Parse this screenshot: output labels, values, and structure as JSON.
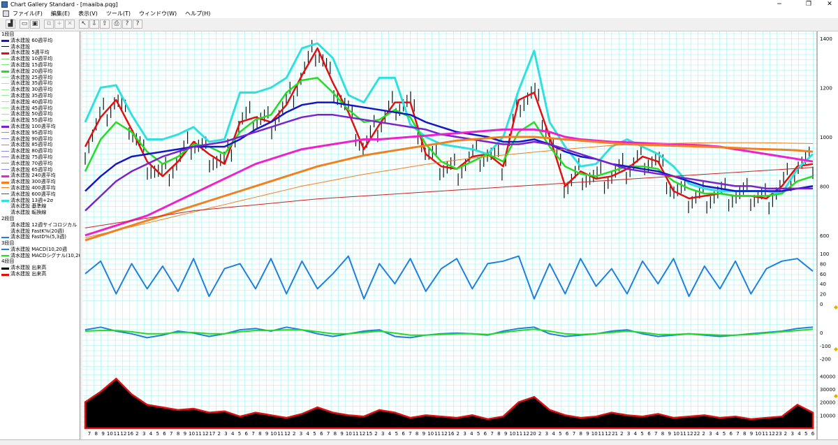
{
  "window": {
    "title": "Chart Gallery Standard - [maaiba.pqg]",
    "minimize": "−",
    "maximize": "❐",
    "close": "✕"
  },
  "menu": [
    "ファイル(F)",
    "編集(E)",
    "表示(V)",
    "ツール(T)",
    "ウィンドウ(W)",
    "ヘルプ(H)"
  ],
  "toolbar": [
    {
      "icon": "chart-icon",
      "glyph": "▟"
    },
    {
      "icon": "open-icon",
      "glyph": "▭"
    },
    {
      "icon": "save-icon",
      "glyph": "▣"
    },
    {
      "icon": "copy-icon",
      "glyph": "⧉"
    },
    {
      "icon": "add-icon",
      "glyph": "+"
    },
    {
      "icon": "delete-icon",
      "glyph": "✕"
    },
    {
      "icon": "cursor-icon",
      "glyph": "↖"
    },
    {
      "icon": "down-icon",
      "glyph": "⇩"
    },
    {
      "icon": "up-icon",
      "glyph": "⇧"
    },
    {
      "icon": "print-icon",
      "glyph": "⎙"
    },
    {
      "icon": "info-icon",
      "glyph": "?"
    },
    {
      "icon": "help-icon",
      "glyph": "?"
    }
  ],
  "legend": [
    {
      "text": "1段目",
      "section": true
    },
    {
      "text": "清水建設 60週平均",
      "color": "#1515c8",
      "w": 3
    },
    {
      "text": "清水建設",
      "color": "#000000",
      "w": 1
    },
    {
      "text": "清水建設 5週平均",
      "color": "#e01010",
      "w": 3
    },
    {
      "text": "清水建設 10週平均",
      "color": "#80e080",
      "w": 1
    },
    {
      "text": "清水建設 15週平均",
      "color": "#80e080",
      "w": 1
    },
    {
      "text": "清水建設 20週平均",
      "color": "#22dd22",
      "w": 3
    },
    {
      "text": "清水建設 25週平均",
      "color": "#a0e8a0",
      "w": 1
    },
    {
      "text": "清水建設 35週平均",
      "color": "#a0e8a0",
      "w": 1
    },
    {
      "text": "清水建設 30週平均",
      "color": "#a0e8a0",
      "w": 1
    },
    {
      "text": "清水建設 35週平均",
      "color": "#a0e8a0",
      "w": 1
    },
    {
      "text": "清水建設 40週平均",
      "color": "#a0e8a0",
      "w": 1
    },
    {
      "text": "清水建設 45週平均",
      "color": "#a0e8a0",
      "w": 1
    },
    {
      "text": "清水建設 50週平均",
      "color": "#a0e8a0",
      "w": 1
    },
    {
      "text": "清水建設 55週平均",
      "color": "#a0e8a0",
      "w": 1
    },
    {
      "text": "清水建設 100週平均",
      "color": "#7a22cc",
      "w": 3
    },
    {
      "text": "清水建設 95週平均",
      "color": "#8888e0",
      "w": 1
    },
    {
      "text": "清水建設 90週平均",
      "color": "#8888e0",
      "w": 1
    },
    {
      "text": "清水建設 85週平均",
      "color": "#8888e0",
      "w": 1
    },
    {
      "text": "清水建設 80週平均",
      "color": "#8888e0",
      "w": 1
    },
    {
      "text": "清水建設 75週平均",
      "color": "#8888e0",
      "w": 1
    },
    {
      "text": "清水建設 70週平均",
      "color": "#8888e0",
      "w": 1
    },
    {
      "text": "清水建設 65週平均",
      "color": "#8888e0",
      "w": 1
    },
    {
      "text": "清水建設 240週平均",
      "color": "#ee22cc",
      "w": 3
    },
    {
      "text": "清水建設 300週平均",
      "color": "#f08020",
      "w": 3
    },
    {
      "text": "清水建設 400週平均",
      "color": "#f08020",
      "w": 1
    },
    {
      "text": "清水建設 600週平均",
      "color": "#d02020",
      "w": 1
    },
    {
      "text": "清水建設 13週+2σ",
      "color": "#30e0e0",
      "w": 3
    },
    {
      "text": "清水建設 基準線",
      "color": null,
      "w": 0
    },
    {
      "text": "清水建設 転換線",
      "color": null,
      "w": 0
    },
    {
      "text": "2段目",
      "section": true
    },
    {
      "text": "清水建設 12週サイコロジカル",
      "color": null,
      "w": 0
    },
    {
      "text": "清水建設 FastK%(20週)",
      "color": null,
      "w": 0
    },
    {
      "text": "清水建設 FastD%(5,3週)",
      "color": "#1e7fe0",
      "w": 2
    },
    {
      "text": "3段目",
      "section": true
    },
    {
      "text": "清水建設 MACD(10,20週",
      "color": "#1e7fe0",
      "w": 2
    },
    {
      "text": "清水建設 MACDシグナル(10,20",
      "color": "#22dd22",
      "w": 2
    },
    {
      "text": "4段目",
      "section": true
    },
    {
      "text": "清水建設 出来高",
      "color": "#000000",
      "w": 3
    },
    {
      "text": "清水建設 出来高",
      "color": "#e01010",
      "w": 3
    }
  ],
  "chart_data": [
    {
      "type": "line",
      "panel": "1段目",
      "y_ticks": [
        "1400",
        "1200",
        "1000",
        "800",
        "600"
      ],
      "ylim": [
        540,
        1420
      ],
      "grid": true,
      "series": [
        {
          "name": "清水建設 5週平均",
          "color": "#e01010",
          "width": 2.5,
          "values": [
            960,
            1080,
            1150,
            1030,
            900,
            840,
            900,
            980,
            930,
            890,
            1060,
            1080,
            1060,
            1130,
            1250,
            1360,
            1220,
            1100,
            950,
            1050,
            1140,
            1140,
            930,
            880,
            870,
            920,
            930,
            880,
            1150,
            1180,
            1000,
            800,
            860,
            830,
            840,
            870,
            920,
            900,
            780,
            750,
            760,
            770,
            760,
            760,
            750,
            800,
            880,
            890
          ]
        },
        {
          "name": "清水建設 13週+2σ",
          "color": "#30e0e0",
          "width": 3,
          "values": [
            1060,
            1200,
            1210,
            1090,
            990,
            990,
            1010,
            1040,
            980,
            990,
            1180,
            1180,
            1200,
            1240,
            1360,
            1380,
            1320,
            1170,
            1140,
            1240,
            1240,
            1050,
            1000,
            970,
            960,
            950,
            930,
            1000,
            1190,
            1350,
            1060,
            960,
            880,
            890,
            960,
            990,
            960,
            930,
            880,
            810,
            790,
            780,
            780,
            780,
            780,
            770,
            870,
            930
          ]
        },
        {
          "name": "清水建設 20週平均",
          "color": "#22dd22",
          "width": 2.5,
          "values": [
            860,
            990,
            1060,
            1020,
            940,
            890,
            920,
            970,
            960,
            930,
            1020,
            1070,
            1090,
            1180,
            1230,
            1240,
            1180,
            1110,
            1060,
            1070,
            1110,
            1080,
            970,
            900,
            870,
            900,
            930,
            900,
            1020,
            1060,
            960,
            880,
            850,
            840,
            860,
            880,
            880,
            870,
            820,
            790,
            770,
            770,
            760,
            760,
            760,
            770,
            820,
            840
          ]
        },
        {
          "name": "清水建設 60週平均",
          "color": "#1515c8",
          "width": 2.5,
          "values": [
            780,
            840,
            890,
            920,
            930,
            940,
            950,
            960,
            960,
            960,
            990,
            1030,
            1060,
            1100,
            1130,
            1140,
            1140,
            1130,
            1120,
            1110,
            1100,
            1090,
            1060,
            1040,
            1020,
            1010,
            1000,
            980,
            980,
            990,
            970,
            940,
            920,
            910,
            890,
            880,
            870,
            860,
            840,
            820,
            800,
            790,
            780,
            780,
            780,
            780,
            790,
            800
          ]
        },
        {
          "name": "清水建設 100週平均",
          "color": "#7a22cc",
          "width": 2.5,
          "values": [
            700,
            760,
            820,
            860,
            890,
            920,
            940,
            960,
            970,
            980,
            1000,
            1020,
            1040,
            1060,
            1080,
            1090,
            1090,
            1080,
            1070,
            1060,
            1050,
            1040,
            1030,
            1010,
            1000,
            990,
            980,
            970,
            970,
            980,
            970,
            950,
            930,
            910,
            890,
            870,
            860,
            850,
            840,
            830,
            820,
            810,
            800,
            800,
            790,
            790,
            790,
            790
          ]
        },
        {
          "name": "清水建設 240週平均",
          "color": "#ee22cc",
          "width": 3,
          "values": [
            600,
            620,
            640,
            660,
            680,
            710,
            740,
            770,
            800,
            830,
            860,
            890,
            910,
            930,
            950,
            960,
            970,
            980,
            990,
            990,
            995,
            1000,
            1005,
            1010,
            1015,
            1020,
            1025,
            1030,
            1030,
            1030,
            1020,
            1000,
            990,
            985,
            980,
            978,
            975,
            972,
            970,
            968,
            965,
            960,
            950,
            940,
            930,
            920,
            910,
            900
          ]
        },
        {
          "name": "清水建設 300週平均",
          "color": "#f08020",
          "width": 3,
          "values": [
            580,
            600,
            620,
            640,
            660,
            680,
            700,
            720,
            740,
            760,
            780,
            800,
            820,
            840,
            860,
            880,
            895,
            910,
            925,
            935,
            945,
            955,
            965,
            975,
            985,
            990,
            995,
            1000,
            1000,
            1000,
            995,
            990,
            985,
            980,
            975,
            970,
            968,
            966,
            964,
            962,
            960,
            958,
            955,
            952,
            950,
            948,
            945,
            940
          ]
        },
        {
          "name": "清水建設 400週平均",
          "color": "#f08020",
          "width": 1,
          "values": [
            590,
            605,
            620,
            635,
            650,
            665,
            680,
            695,
            710,
            725,
            740,
            755,
            770,
            785,
            800,
            812,
            824,
            836,
            848,
            858,
            868,
            878,
            888,
            898,
            906,
            914,
            920,
            926,
            932,
            938,
            944,
            950,
            955,
            960,
            965,
            968,
            970,
            972,
            974,
            975,
            976,
            977,
            977,
            977,
            976,
            975,
            974,
            973
          ]
        },
        {
          "name": "清水建設 600週平均",
          "color": "#d02020",
          "width": 1,
          "values": [
            630,
            640,
            650,
            660,
            670,
            680,
            690,
            700,
            706,
            712,
            718,
            724,
            730,
            736,
            742,
            748,
            752,
            756,
            760,
            764,
            768,
            772,
            776,
            780,
            784,
            788,
            792,
            796,
            800,
            804,
            808,
            812,
            816,
            820,
            824,
            828,
            832,
            836,
            840,
            844,
            848,
            852,
            856,
            860,
            864,
            868,
            872,
            876
          ]
        }
      ]
    },
    {
      "type": "line",
      "panel": "2段目",
      "y_ticks": [
        "100",
        "80",
        "60",
        "40",
        "20",
        "0"
      ],
      "ylim": [
        0,
        100
      ],
      "series": [
        {
          "name": "清水建設 FastD%(5,3週)",
          "color": "#1e7fe0",
          "values": [
            60,
            85,
            20,
            80,
            30,
            75,
            25,
            90,
            15,
            70,
            80,
            30,
            90,
            20,
            85,
            30,
            60,
            95,
            10,
            80,
            40,
            90,
            25,
            70,
            90,
            30,
            80,
            85,
            95,
            10,
            80,
            20,
            90,
            35,
            70,
            20,
            85,
            40,
            90,
            15,
            75,
            30,
            85,
            20,
            70,
            85,
            90,
            65
          ]
        }
      ]
    },
    {
      "type": "line",
      "panel": "3段目",
      "y_ticks": [
        "0",
        "-100",
        "-200"
      ],
      "ylim": [
        -260,
        100
      ],
      "series": [
        {
          "name": "清水建設 MACD(10,20週",
          "color": "#1e7fe0",
          "values": [
            20,
            40,
            10,
            -10,
            -40,
            -20,
            10,
            -5,
            -30,
            -10,
            20,
            30,
            10,
            40,
            20,
            -10,
            -30,
            -10,
            10,
            20,
            -30,
            -40,
            -20,
            -10,
            -5,
            -10,
            -20,
            10,
            30,
            40,
            -10,
            -30,
            -20,
            -10,
            10,
            20,
            -10,
            -30,
            -20,
            -10,
            -20,
            -30,
            -20,
            -10,
            0,
            10,
            30,
            40
          ]
        },
        {
          "name": "清水建設 MACDシグナル(10,20",
          "color": "#22dd22",
          "values": [
            10,
            15,
            15,
            5,
            -10,
            -10,
            0,
            0,
            -10,
            -10,
            5,
            15,
            15,
            20,
            20,
            5,
            -10,
            -10,
            0,
            10,
            -5,
            -20,
            -20,
            -15,
            -10,
            -10,
            -15,
            0,
            15,
            25,
            10,
            -10,
            -15,
            -10,
            0,
            10,
            0,
            -15,
            -15,
            -10,
            -15,
            -20,
            -20,
            -15,
            -5,
            5,
            15,
            25
          ]
        }
      ]
    },
    {
      "type": "area",
      "panel": "4段目",
      "y_ticks": [
        "40000",
        "30000",
        "20000",
        "10000"
      ],
      "ylim": [
        0,
        45000
      ],
      "series": [
        {
          "name": "清水建設 出来高",
          "color": "#e01010",
          "values": [
            20000,
            28000,
            38000,
            26000,
            18000,
            16000,
            14000,
            15000,
            12000,
            13000,
            9000,
            12000,
            10000,
            8000,
            11000,
            16000,
            12000,
            10000,
            9000,
            14000,
            12000,
            8000,
            10000,
            9000,
            8000,
            10000,
            7000,
            9000,
            20000,
            24000,
            14000,
            10000,
            8000,
            9000,
            12000,
            10000,
            9000,
            11000,
            8000,
            9000,
            10000,
            8000,
            9000,
            7000,
            8000,
            9000,
            18000,
            12000
          ]
        }
      ]
    }
  ],
  "x_ticks": [
    "7",
    "8",
    "9",
    "10",
    "11",
    "12",
    "16",
    "2",
    "3",
    "4",
    "5",
    "6",
    "7",
    "8",
    "9",
    "10",
    "11",
    "12",
    "17",
    "2",
    "3",
    "4",
    "5",
    "6",
    "7",
    "8",
    "9",
    "10",
    "11",
    "12",
    "2",
    "3",
    "4",
    "5",
    "6",
    "7",
    "8",
    "9",
    "10",
    "11",
    "12",
    "15",
    "2",
    "3",
    "4",
    "5",
    "6",
    "7",
    "8",
    "9",
    "10",
    "11",
    "12",
    "16",
    "2",
    "3",
    "4",
    "5",
    "6",
    "7",
    "8",
    "9",
    "10",
    "11",
    "12",
    "20",
    "2",
    "3",
    "4",
    "5",
    "6",
    "7",
    "8",
    "9",
    "10",
    "11",
    "12",
    "21",
    "2",
    "3",
    "4",
    "5",
    "6",
    "7",
    "8",
    "9",
    "10",
    "11",
    "12",
    "22",
    "2",
    "3",
    "4",
    "5",
    "6",
    "7",
    "8",
    "9",
    "10",
    "11",
    "12",
    "23",
    "2",
    "3",
    "4",
    "5",
    "6"
  ],
  "y_unit_right": ""
}
